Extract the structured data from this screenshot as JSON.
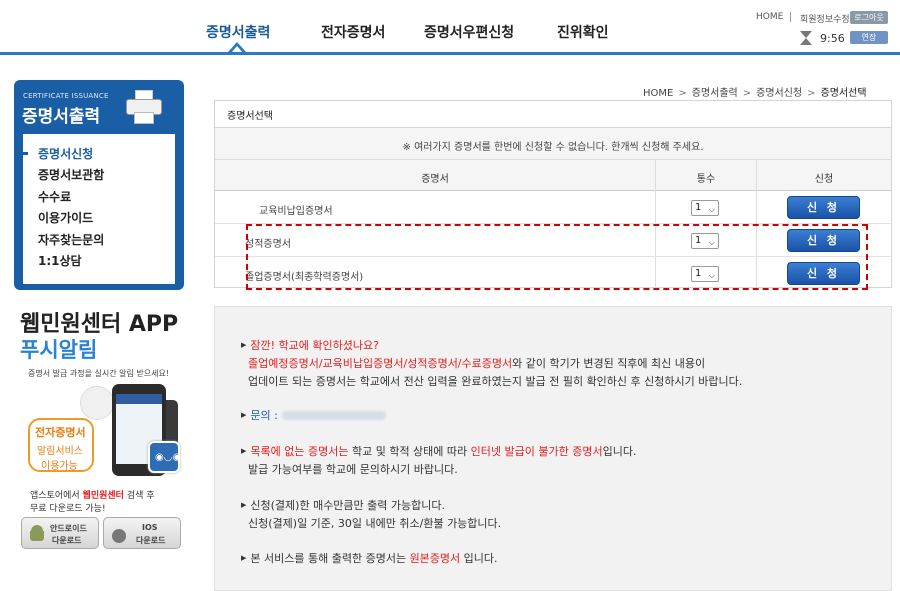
{
  "header": {
    "gnb": [
      "증명서출력",
      "전자증명서",
      "증명서우편신청",
      "진위확인"
    ],
    "util_home": "HOME",
    "util_edit": "회원정보수정",
    "logout_label": "로그아웃",
    "timer": "9:56",
    "extend_label": "연장"
  },
  "sidebar": {
    "eng_title": "CERTIFICATE ISSUANCE",
    "title": "증명서출력",
    "items": [
      {
        "label": "증명서신청"
      },
      {
        "label": "증명서보관함"
      },
      {
        "label": "수수료"
      },
      {
        "label": "이용가이드"
      },
      {
        "label": "자주찾는문의"
      },
      {
        "label": "1:1상담"
      }
    ],
    "app_title": "웹민원센터 APP",
    "app_sub": "푸시알림",
    "app_desc": "증명서 발급 과정을 실시간 알림 받으세요!",
    "callout_l1": "전자증명서",
    "callout_l2": "알림서비스",
    "callout_l3": "이용가능",
    "store_pre": "앱스토어에서 ",
    "store_brand": "웹민원센터",
    "store_post": " 검색 후",
    "store_l2": "무료 다운로드 가능!",
    "android_l1": "안드로이드",
    "android_l2": "다운로드",
    "ios_l1": "IOS",
    "ios_l2": "다운로드"
  },
  "breadcrumb": [
    "HOME",
    "증명서출력",
    "증명서신청",
    "증명서선택"
  ],
  "panel": {
    "title": "증명서선택",
    "notice": "※ 여러가지 증명서를 한번에 신청할 수 없습니다. 한개씩 신청해 주세요.",
    "headers": {
      "name": "증명서",
      "qty": "통수",
      "apply": "신청"
    },
    "rows": [
      {
        "name": "교육비납입증명서",
        "qty": "1",
        "apply": "신 청"
      },
      {
        "name": "성적증명서",
        "qty": "1",
        "apply": "신 청"
      },
      {
        "name": "졸업증명서(최종학력증명서)",
        "qty": "1",
        "apply": "신 청"
      }
    ]
  },
  "info": {
    "l1_red": "잠깐! 학교에 확인하셨나요?",
    "l2_red": "졸업예정증명서/교육비납입증명서/성적증명서/수료증명서",
    "l2_post": "와 같이 학기가 변경된 직후에 최신 내용이",
    "l3": "업데이트 되는 증명서는 학교에서 전산 입력을 완료하였는지 발급 전 필히 확인하신 후 신청하시기 바랍니다.",
    "contact_label": "문의 :",
    "l5_red": "목록에 없는 증명서는",
    "l5_mid": " 학교 및 학적 상태에 따라 ",
    "l5_red2": "인터넷 발급이 불가한 증명서",
    "l5_post": "입니다.",
    "l6": "발급 가능여부를 학교에 문의하시기 바랍니다.",
    "l7": "신청(결제)한 매수만큼만 출력 가능합니다.",
    "l8": "신청(결제)일 기준, 30일 내에만 취소/환불 가능합니다.",
    "l9_pre": "본 서비스를 통해 출력한 증명서는 ",
    "l9_red": "원본증명서",
    "l9_post": " 입니다."
  }
}
